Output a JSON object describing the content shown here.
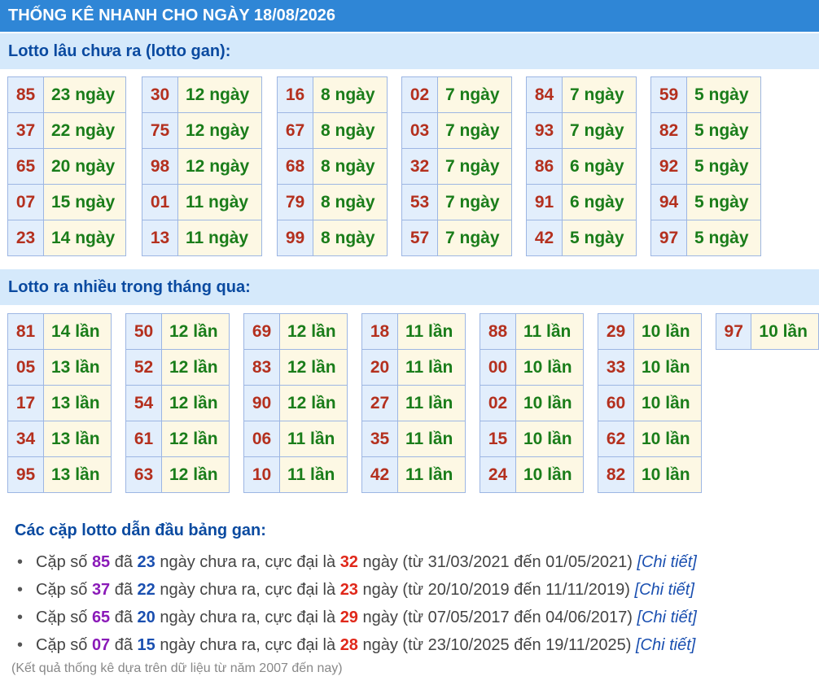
{
  "header": {
    "title": "THỐNG KÊ NHANH CHO NGÀY 18/08/2026"
  },
  "gan_section": {
    "title": "Lotto lâu chưa ra (lotto gan):",
    "groups": [
      [
        {
          "num": "85",
          "val": "23 ngày"
        },
        {
          "num": "37",
          "val": "22 ngày"
        },
        {
          "num": "65",
          "val": "20 ngày"
        },
        {
          "num": "07",
          "val": "15 ngày"
        },
        {
          "num": "23",
          "val": "14 ngày"
        }
      ],
      [
        {
          "num": "30",
          "val": "12 ngày"
        },
        {
          "num": "75",
          "val": "12 ngày"
        },
        {
          "num": "98",
          "val": "12 ngày"
        },
        {
          "num": "01",
          "val": "11 ngày"
        },
        {
          "num": "13",
          "val": "11 ngày"
        }
      ],
      [
        {
          "num": "16",
          "val": "8 ngày"
        },
        {
          "num": "67",
          "val": "8 ngày"
        },
        {
          "num": "68",
          "val": "8 ngày"
        },
        {
          "num": "79",
          "val": "8 ngày"
        },
        {
          "num": "99",
          "val": "8 ngày"
        }
      ],
      [
        {
          "num": "02",
          "val": "7 ngày"
        },
        {
          "num": "03",
          "val": "7 ngày"
        },
        {
          "num": "32",
          "val": "7 ngày"
        },
        {
          "num": "53",
          "val": "7 ngày"
        },
        {
          "num": "57",
          "val": "7 ngày"
        }
      ],
      [
        {
          "num": "84",
          "val": "7 ngày"
        },
        {
          "num": "93",
          "val": "7 ngày"
        },
        {
          "num": "86",
          "val": "6 ngày"
        },
        {
          "num": "91",
          "val": "6 ngày"
        },
        {
          "num": "42",
          "val": "5 ngày"
        }
      ],
      [
        {
          "num": "59",
          "val": "5 ngày"
        },
        {
          "num": "82",
          "val": "5 ngày"
        },
        {
          "num": "92",
          "val": "5 ngày"
        },
        {
          "num": "94",
          "val": "5 ngày"
        },
        {
          "num": "97",
          "val": "5 ngày"
        }
      ]
    ]
  },
  "freq_section": {
    "title": "Lotto ra nhiều trong tháng qua:",
    "groups": [
      [
        {
          "num": "81",
          "val": "14 lần"
        },
        {
          "num": "05",
          "val": "13 lần"
        },
        {
          "num": "17",
          "val": "13 lần"
        },
        {
          "num": "34",
          "val": "13 lần"
        },
        {
          "num": "95",
          "val": "13 lần"
        }
      ],
      [
        {
          "num": "50",
          "val": "12 lần"
        },
        {
          "num": "52",
          "val": "12 lần"
        },
        {
          "num": "54",
          "val": "12 lần"
        },
        {
          "num": "61",
          "val": "12 lần"
        },
        {
          "num": "63",
          "val": "12 lần"
        }
      ],
      [
        {
          "num": "69",
          "val": "12 lần"
        },
        {
          "num": "83",
          "val": "12 lần"
        },
        {
          "num": "90",
          "val": "12 lần"
        },
        {
          "num": "06",
          "val": "11 lần"
        },
        {
          "num": "10",
          "val": "11 lần"
        }
      ],
      [
        {
          "num": "18",
          "val": "11 lần"
        },
        {
          "num": "20",
          "val": "11 lần"
        },
        {
          "num": "27",
          "val": "11 lần"
        },
        {
          "num": "35",
          "val": "11 lần"
        },
        {
          "num": "42",
          "val": "11 lần"
        }
      ],
      [
        {
          "num": "88",
          "val": "11 lần"
        },
        {
          "num": "00",
          "val": "10 lần"
        },
        {
          "num": "02",
          "val": "10 lần"
        },
        {
          "num": "15",
          "val": "10 lần"
        },
        {
          "num": "24",
          "val": "10 lần"
        }
      ],
      [
        {
          "num": "29",
          "val": "10 lần"
        },
        {
          "num": "33",
          "val": "10 lần"
        },
        {
          "num": "60",
          "val": "10 lần"
        },
        {
          "num": "62",
          "val": "10 lần"
        },
        {
          "num": "82",
          "val": "10 lần"
        }
      ],
      [
        {
          "num": "97",
          "val": "10 lần"
        }
      ]
    ]
  },
  "leaders": {
    "title": "Các cặp lotto dẫn đầu bảng gan:",
    "bullet": "•",
    "pairs": [
      {
        "p1": "Cặp số ",
        "num": "85",
        "p2": " đã ",
        "days": "23",
        "p3": " ngày chưa ra, cực đại là ",
        "max": "32",
        "p4": " ngày (từ 31/03/2021 đến 01/05/2021) ",
        "link": "[Chi tiết]"
      },
      {
        "p1": "Cặp số ",
        "num": "37",
        "p2": " đã ",
        "days": "22",
        "p3": " ngày chưa ra, cực đại là ",
        "max": "23",
        "p4": " ngày (từ 20/10/2019 đến 11/11/2019) ",
        "link": "[Chi tiết]"
      },
      {
        "p1": "Cặp số ",
        "num": "65",
        "p2": " đã ",
        "days": "20",
        "p3": " ngày chưa ra, cực đại là ",
        "max": "29",
        "p4": " ngày (từ 07/05/2017 đến 04/06/2017) ",
        "link": "[Chi tiết]"
      },
      {
        "p1": "Cặp số ",
        "num": "07",
        "p2": " đã ",
        "days": "15",
        "p3": " ngày chưa ra, cực đại là ",
        "max": "28",
        "p4": " ngày (từ 23/10/2025 đến 19/11/2025) ",
        "link": "[Chi tiết]"
      }
    ]
  },
  "footnote": "(Kết quả thống kê dựa trên dữ liệu từ năm 2007 đến nay)"
}
